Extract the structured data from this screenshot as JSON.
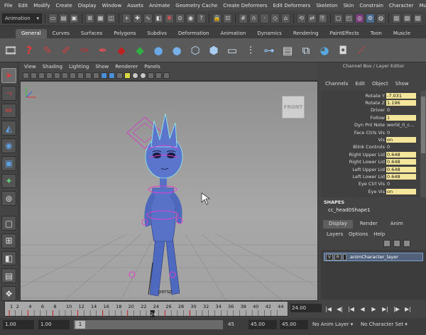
{
  "menubar": [
    "File",
    "Edit",
    "Modify",
    "Create",
    "Display",
    "Window",
    "Assets",
    "Animate",
    "Geometry Cache",
    "Create Deformers",
    "Edit Deformers",
    "Skeleton",
    "Skin",
    "Constrain",
    "Character",
    "Muscle"
  ],
  "status": {
    "menu_set": "Animation"
  },
  "shelf_tabs": [
    "General",
    "Curves",
    "Surfaces",
    "Polygons",
    "Subdivs",
    "Deformation",
    "Animation",
    "Dynamics",
    "Rendering",
    "PaintEffects",
    "Toon",
    "Muscle"
  ],
  "shelf_active": "General",
  "viewport": {
    "menus": [
      "View",
      "Shading",
      "Lighting",
      "Show",
      "Renderer",
      "Panels"
    ],
    "cube_label": "FRONT",
    "camera_label": "persp"
  },
  "right_panel": {
    "title": "Channel Box / Layer Editor",
    "menus": [
      "Channels",
      "Edit",
      "Object",
      "Show"
    ],
    "channels": [
      {
        "label": "Rotate Y",
        "value": "-7.031",
        "hl": true
      },
      {
        "label": "Rotate Z",
        "value": "1.196",
        "hl": true
      },
      {
        "label": "Driver",
        "value": "0",
        "hl": false
      },
      {
        "label": "Follow",
        "value": "1",
        "hl": true
      },
      {
        "label": "Dyn Pnt Note",
        "value": "world_0_c...",
        "hl": false
      },
      {
        "label": "Face Ctrls Vis",
        "value": "0",
        "hl": false
      },
      {
        "label": "Vis",
        "value": "on",
        "hl": true
      },
      {
        "label": "Blink Controls",
        "value": "0",
        "hl": false
      },
      {
        "label": "Right Upper Lid",
        "value": "0.648",
        "hl": true
      },
      {
        "label": "Right Lower Lid",
        "value": "0.648",
        "hl": true
      },
      {
        "label": "Left Upper Lid",
        "value": "0.648",
        "hl": true
      },
      {
        "label": "Left Lower Lid",
        "value": "0.648",
        "hl": true
      },
      {
        "label": "Eye Ctrl Vis",
        "value": "0",
        "hl": false
      },
      {
        "label": "Eye Vis",
        "value": "on",
        "hl": true
      }
    ],
    "shapes_header": "SHAPES",
    "shape_name": "cc_head0Shape1"
  },
  "layer_editor": {
    "tabs": [
      "Display",
      "Render",
      "Anim"
    ],
    "menus": [
      "Layers",
      "Options",
      "Help"
    ],
    "layer": {
      "v": "V",
      "r": "R",
      "name": "animCharacter_layer"
    }
  },
  "timeline": {
    "ticks": [
      "1",
      "2",
      "4",
      "6",
      "8",
      "10",
      "12",
      "14",
      "16",
      "18",
      "20",
      "22",
      "24",
      "26",
      "28",
      "30",
      "32",
      "34",
      "36",
      "38",
      "40",
      "42",
      "44"
    ],
    "current_frame": "24",
    "time_field": "24.00"
  },
  "range": {
    "start": "1.00",
    "anim_start": "1.00",
    "handle": "1",
    "end_num": "45",
    "anim_end": "45.00",
    "end": "45.00",
    "anim_layer": "No Anim Layer",
    "char_set": "No Character Set"
  }
}
